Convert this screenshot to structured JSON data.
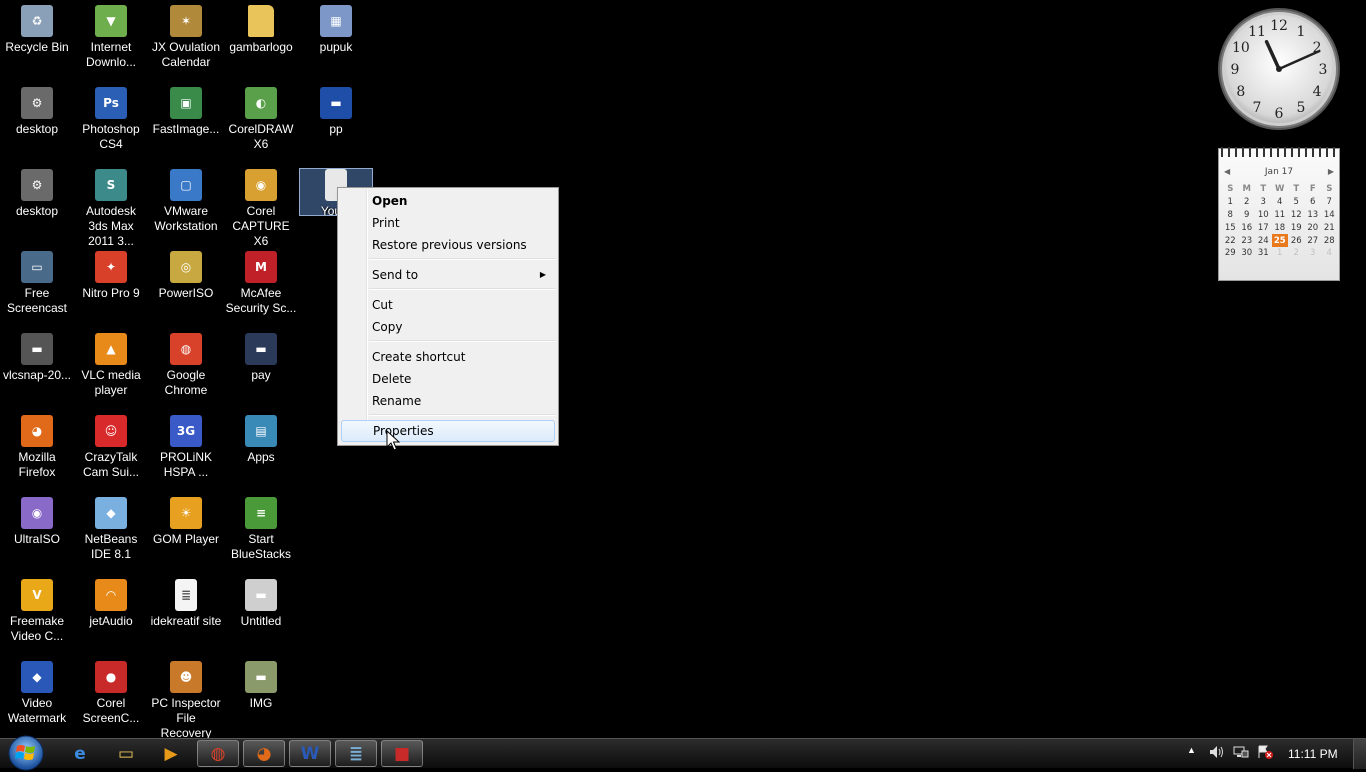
{
  "desktop_icons": [
    {
      "label": "Recycle Bin",
      "icon": "recycle-bin-icon",
      "color": "#8aa0b8",
      "glyph": "♻"
    },
    {
      "label": "Internet Downlo...",
      "icon": "internet-download-manager-icon",
      "color": "#6fae4c",
      "glyph": "▼"
    },
    {
      "label": "JX Ovulation Calendar",
      "icon": "jx-ovulation-calendar-icon",
      "color": "#b08a3a",
      "glyph": "✶"
    },
    {
      "label": "gambarlogo",
      "icon": "folder-icon",
      "color": "#e8c45a",
      "glyph": ""
    },
    {
      "label": "pupuk",
      "icon": "image-file-icon",
      "color": "#7d98c8",
      "glyph": "▦"
    },
    {
      "label": "desktop",
      "icon": "gear-settings-icon",
      "color": "#6a6a6a",
      "glyph": "⚙"
    },
    {
      "label": "Photoshop CS4",
      "icon": "photoshop-icon",
      "color": "#2a5fb5",
      "glyph": "Ps"
    },
    {
      "label": "FastImage...",
      "icon": "fastimage-icon",
      "color": "#3a8a4a",
      "glyph": "▣"
    },
    {
      "label": "CorelDRAW X6",
      "icon": "coreldraw-icon",
      "color": "#5aa04a",
      "glyph": "◐"
    },
    {
      "label": "pp",
      "icon": "image-thumbnail-icon",
      "color": "#1e4ea8",
      "glyph": "▬"
    },
    {
      "label": "desktop",
      "icon": "gear-settings-icon",
      "color": "#6a6a6a",
      "glyph": "⚙"
    },
    {
      "label": "Autodesk 3ds Max 2011 3...",
      "icon": "3ds-max-icon",
      "color": "#3c8a8a",
      "glyph": "S"
    },
    {
      "label": "VMware Workstation",
      "icon": "vmware-icon",
      "color": "#3a78c8",
      "glyph": "▢"
    },
    {
      "label": "Corel CAPTURE X6",
      "icon": "corel-capture-icon",
      "color": "#d8a030",
      "glyph": "◉"
    },
    {
      "label": "You...",
      "icon": "shortcut-file-icon",
      "color": "#e8e8e8",
      "glyph": ""
    },
    {
      "label": "Free Screencast",
      "icon": "free-screencast-icon",
      "color": "#4a6a8a",
      "glyph": "▭"
    },
    {
      "label": "Nitro Pro 9",
      "icon": "nitro-pro-icon",
      "color": "#d8402a",
      "glyph": "✦"
    },
    {
      "label": "PowerISO",
      "icon": "poweriso-icon",
      "color": "#c8a840",
      "glyph": "◎"
    },
    {
      "label": "McAfee Security Sc...",
      "icon": "mcafee-icon",
      "color": "#c02028",
      "glyph": "M"
    },
    {
      "label": "vlcsnap-20...",
      "icon": "image-thumbnail-icon",
      "color": "#555",
      "glyph": "▬"
    },
    {
      "label": "VLC media player",
      "icon": "vlc-icon",
      "color": "#e88a1a",
      "glyph": "▲"
    },
    {
      "label": "Google Chrome",
      "icon": "chrome-icon",
      "color": "#d8422a",
      "glyph": "◍"
    },
    {
      "label": "pay",
      "icon": "image-thumbnail-icon",
      "color": "#2a3a58",
      "glyph": "▬"
    },
    {
      "label": "Mozilla Firefox",
      "icon": "firefox-icon",
      "color": "#e06a1a",
      "glyph": "◕"
    },
    {
      "label": "CrazyTalk Cam Sui...",
      "icon": "crazytalk-icon",
      "color": "#d82a2a",
      "glyph": "☺"
    },
    {
      "label": "PROLiNK HSPA ...",
      "icon": "prolink-icon",
      "color": "#3a5ac8",
      "glyph": "3G"
    },
    {
      "label": "Apps",
      "icon": "apps-icon",
      "color": "#3a8ab8",
      "glyph": "▤"
    },
    {
      "label": "UltraISO",
      "icon": "ultraiso-icon",
      "color": "#8a6ac8",
      "glyph": "◉"
    },
    {
      "label": "NetBeans IDE 8.1",
      "icon": "netbeans-icon",
      "color": "#7ab0e0",
      "glyph": "◆"
    },
    {
      "label": "GOM Player",
      "icon": "gom-player-icon",
      "color": "#e8a020",
      "glyph": "☀"
    },
    {
      "label": "Start BlueStacks",
      "icon": "bluestacks-icon",
      "color": "#4a9a3a",
      "glyph": "≡"
    },
    {
      "label": "Freemake Video C...",
      "icon": "freemake-icon",
      "color": "#e8a818",
      "glyph": "V"
    },
    {
      "label": "jetAudio",
      "icon": "jetaudio-icon",
      "color": "#e88a1a",
      "glyph": "◠"
    },
    {
      "label": "idekreatif site",
      "icon": "text-file-icon",
      "color": "#f4f4f4",
      "glyph": "≣"
    },
    {
      "label": "Untitled",
      "icon": "image-thumbnail-icon",
      "color": "#cfcfcf",
      "glyph": "▬"
    },
    {
      "label": "Video Watermark",
      "icon": "video-watermark-icon",
      "color": "#2a58b8",
      "glyph": "◆"
    },
    {
      "label": "Corel ScreenC...",
      "icon": "corel-screencap-icon",
      "color": "#c82a2a",
      "glyph": "●"
    },
    {
      "label": "PC Inspector File Recovery",
      "icon": "pc-inspector-icon",
      "color": "#c87a2a",
      "glyph": "☻"
    },
    {
      "label": "IMG",
      "icon": "image-thumbnail-icon",
      "color": "#8a9a6a",
      "glyph": "▬"
    }
  ],
  "context_menu": {
    "items": [
      {
        "label": "Open"
      },
      {
        "label": "Print"
      },
      {
        "label": "Restore previous versions"
      },
      {
        "label": "Send to"
      },
      {
        "label": "Cut"
      },
      {
        "label": "Copy"
      },
      {
        "label": "Create shortcut"
      },
      {
        "label": "Delete"
      },
      {
        "label": "Rename"
      },
      {
        "label": "Properties"
      }
    ],
    "default_item": "Open",
    "highlighted_item": "Properties",
    "submenu_item": "Send to"
  },
  "calendar": {
    "month_label": "Jan 17",
    "weekdays": [
      "S",
      "M",
      "T",
      "W",
      "T",
      "F",
      "S"
    ],
    "weeks": [
      [
        "1",
        "2",
        "3",
        "4",
        "5",
        "6",
        "7"
      ],
      [
        "8",
        "9",
        "10",
        "11",
        "12",
        "13",
        "14"
      ],
      [
        "15",
        "16",
        "17",
        "18",
        "19",
        "20",
        "21"
      ],
      [
        "22",
        "23",
        "24",
        "25",
        "26",
        "27",
        "28"
      ],
      [
        "29",
        "30",
        "31",
        "1",
        "2",
        "3",
        "4"
      ]
    ],
    "today": "25",
    "accent_color": "#e87a1d"
  },
  "clock_gadget": {
    "hour": 11,
    "minute": 11,
    "numerals": [
      "12",
      "1",
      "2",
      "3",
      "4",
      "5",
      "6",
      "7",
      "8",
      "9",
      "10",
      "11"
    ]
  },
  "taskbar": {
    "pinned": [
      {
        "name": "internet-explorer-icon",
        "running": false
      },
      {
        "name": "windows-explorer-icon",
        "running": false
      },
      {
        "name": "media-player-icon",
        "running": false
      },
      {
        "name": "chrome-icon",
        "running": true
      },
      {
        "name": "firefox-icon",
        "running": true
      },
      {
        "name": "word-icon",
        "running": true
      },
      {
        "name": "notepad-icon",
        "running": true
      },
      {
        "name": "screen-capture-icon",
        "running": true
      }
    ],
    "clock": "11:11 PM"
  }
}
